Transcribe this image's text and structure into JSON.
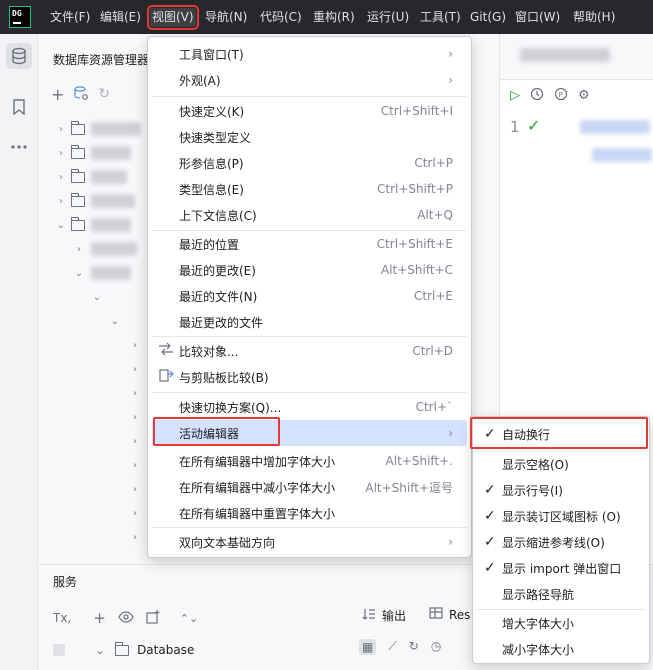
{
  "app": {
    "logo_text": "DG"
  },
  "menubar": {
    "items": [
      {
        "label": "文件(F)"
      },
      {
        "label": "编辑(E)"
      },
      {
        "label": "视图(V)"
      },
      {
        "label": "导航(N)"
      },
      {
        "label": "代码(C)"
      },
      {
        "label": "重构(R)"
      },
      {
        "label": "运行(U)"
      },
      {
        "label": "工具(T)"
      },
      {
        "label": "Git(G)"
      },
      {
        "label": "窗口(W)"
      },
      {
        "label": "帮助(H)"
      }
    ]
  },
  "explorer": {
    "title": "数据库资源管理器"
  },
  "editor": {
    "line_number": "1"
  },
  "services": {
    "title": "服务",
    "tx_label": "Tx,",
    "tab_output": "输出",
    "tab_result": "Res",
    "db_row_label": "Database"
  },
  "view_menu": {
    "items": [
      {
        "label": "工具窗口(T)",
        "shortcut": "",
        "submenu": true
      },
      {
        "label": "外观(A)",
        "shortcut": "",
        "submenu": true
      },
      {
        "label": "快速定义(K)",
        "shortcut": "Ctrl+Shift+I"
      },
      {
        "label": "快速类型定义",
        "shortcut": ""
      },
      {
        "label": "形参信息(P)",
        "shortcut": "Ctrl+P"
      },
      {
        "label": "类型信息(E)",
        "shortcut": "Ctrl+Shift+P"
      },
      {
        "label": "上下文信息(C)",
        "shortcut": "Alt+Q"
      },
      {
        "label": "最近的位置",
        "shortcut": "Ctrl+Shift+E"
      },
      {
        "label": "最近的更改(E)",
        "shortcut": "Alt+Shift+C"
      },
      {
        "label": "最近的文件(N)",
        "shortcut": "Ctrl+E"
      },
      {
        "label": "最近更改的文件",
        "shortcut": ""
      },
      {
        "label": "比较对象...",
        "shortcut": "Ctrl+D"
      },
      {
        "label": "与剪贴板比较(B)",
        "shortcut": ""
      },
      {
        "label": "快速切换方案(Q)...",
        "shortcut": "Ctrl+`"
      },
      {
        "label": "活动编辑器",
        "shortcut": "",
        "submenu": true
      },
      {
        "label": "在所有编辑器中增加字体大小",
        "shortcut": "Alt+Shift+."
      },
      {
        "label": "在所有编辑器中减小字体大小",
        "shortcut": "Alt+Shift+逗号"
      },
      {
        "label": "在所有编辑器中重置字体大小",
        "shortcut": ""
      },
      {
        "label": "双向文本基础方向",
        "shortcut": "",
        "submenu": true
      }
    ]
  },
  "active_editor_submenu": {
    "items": [
      {
        "label": "自动换行",
        "checked": true
      },
      {
        "label": "显示空格(O)",
        "checked": false
      },
      {
        "label": "显示行号(I)",
        "checked": true
      },
      {
        "label": "显示装订区域图标 (O)",
        "checked": true
      },
      {
        "label": "显示缩进参考线(O)",
        "checked": true
      },
      {
        "label": "显示 import 弹出窗口",
        "checked": true
      },
      {
        "label": "显示路径导航",
        "checked": false
      },
      {
        "label": "增大字体大小",
        "checked": false
      },
      {
        "label": "减小字体大小",
        "checked": false
      }
    ]
  },
  "glyphs": {
    "check": "✓",
    "submenu_arrow": "›"
  },
  "colors": {
    "highlight_red": "#e53935",
    "selected_bg": "#d4e2ff",
    "menubar_bg": "#27282c"
  }
}
